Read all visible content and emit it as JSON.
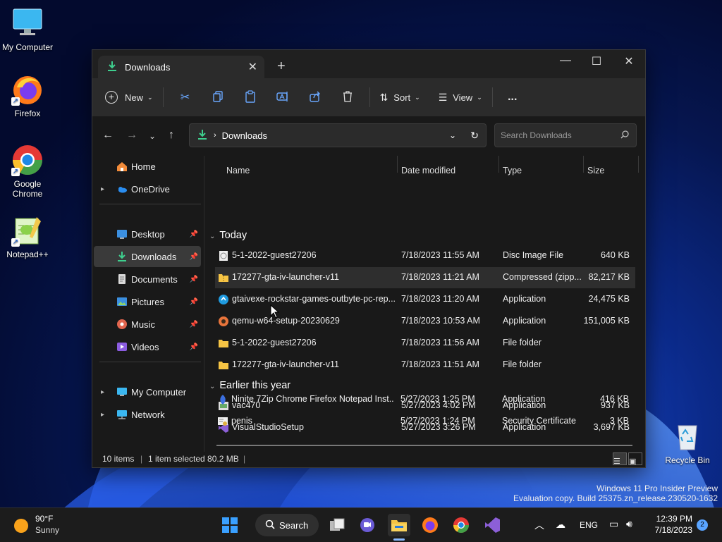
{
  "desktop": {
    "icons": [
      {
        "label": "My Computer"
      },
      {
        "label": "Firefox"
      },
      {
        "label": "Google Chrome"
      },
      {
        "label": "Notepad++"
      },
      {
        "label": "Recycle Bin"
      }
    ]
  },
  "window": {
    "tab_title": "Downloads",
    "toolbar": {
      "new_label": "New",
      "sort_label": "Sort",
      "view_label": "View",
      "more_label": "..."
    },
    "address": {
      "path": "Downloads"
    },
    "search": {
      "placeholder": "Search Downloads"
    },
    "sidebar": [
      {
        "label": "Home"
      },
      {
        "label": "OneDrive"
      },
      {
        "label": "Desktop"
      },
      {
        "label": "Downloads"
      },
      {
        "label": "Documents"
      },
      {
        "label": "Pictures"
      },
      {
        "label": "Music"
      },
      {
        "label": "Videos"
      },
      {
        "label": "My Computer"
      },
      {
        "label": "Network"
      }
    ],
    "columns": {
      "name": "Name",
      "date": "Date modified",
      "type": "Type",
      "size": "Size"
    },
    "groups": {
      "today": "Today",
      "earlier": "Earlier this year"
    },
    "files": [
      {
        "name": "5-1-2022-guest27206",
        "date": "7/18/2023 11:55 AM",
        "type": "Disc Image File",
        "size": "640 KB"
      },
      {
        "name": "172277-gta-iv-launcher-v11",
        "date": "7/18/2023 11:21 AM",
        "type": "Compressed (zipp...",
        "size": "82,217 KB"
      },
      {
        "name": "gtaivexe-rockstar-games-outbyte-pc-rep...",
        "date": "7/18/2023 11:20 AM",
        "type": "Application",
        "size": "24,475 KB"
      },
      {
        "name": "qemu-w64-setup-20230629",
        "date": "7/18/2023 10:53 AM",
        "type": "Application",
        "size": "151,005 KB"
      },
      {
        "name": "5-1-2022-guest27206",
        "date": "7/18/2023 11:56 AM",
        "type": "File folder",
        "size": ""
      },
      {
        "name": "172277-gta-iv-launcher-v11",
        "date": "7/18/2023 11:51 AM",
        "type": "File folder",
        "size": ""
      },
      {
        "name": "vac470",
        "date": "5/27/2023 4:02 PM",
        "type": "Application",
        "size": "937 KB"
      },
      {
        "name": "VisualStudioSetup",
        "date": "5/27/2023 3:26 PM",
        "type": "Application",
        "size": "3,697 KB"
      },
      {
        "name": "Ninite 7Zip Chrome Firefox Notepad Inst...",
        "date": "5/27/2023 1:25 PM",
        "type": "Application",
        "size": "416 KB"
      },
      {
        "name": "penis",
        "date": "5/27/2023 1:24 PM",
        "type": "Security Certificate",
        "size": "3 KB"
      }
    ],
    "status": {
      "items": "10 items",
      "selected": "1 item selected  80.2 MB"
    }
  },
  "watermark": {
    "line1": "Windows 11 Pro Insider Preview",
    "line2": "Evaluation copy. Build 25375.zn_release.230520-1632"
  },
  "taskbar": {
    "weather_temp": "90°F",
    "weather_desc": "Sunny",
    "search_label": "Search",
    "language": "ENG",
    "time": "12:39 PM",
    "date": "7/18/2023",
    "notification_count": "2"
  },
  "colors": {
    "accent": "#0a84ff",
    "folder": "#f6c444",
    "selection": "#3a3a3a"
  }
}
